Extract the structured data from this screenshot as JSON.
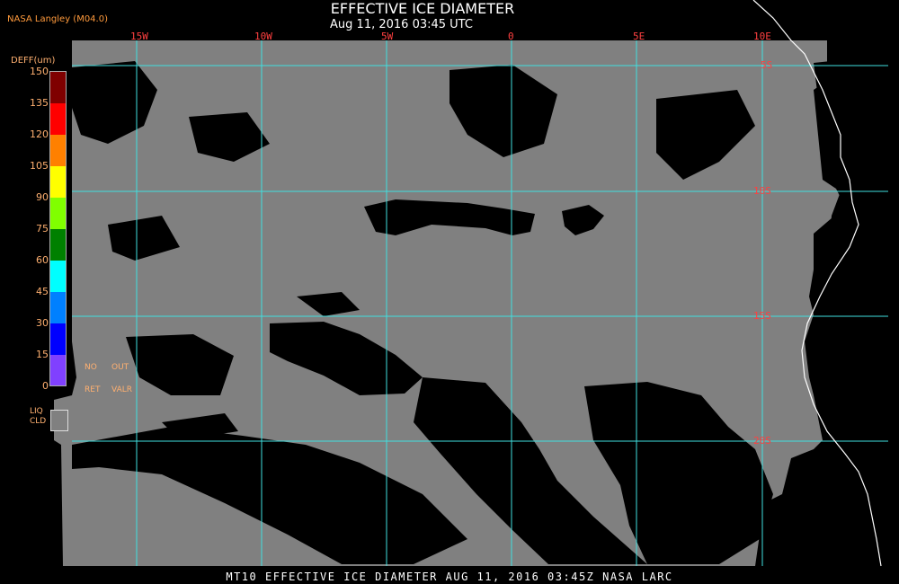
{
  "header": {
    "org": "NASA Langley (M04.0)",
    "title": "EFFECTIVE ICE DIAMETER",
    "subtitle": "Aug 11, 2016 03:45 UTC"
  },
  "legend": {
    "units_label": "DEFF(um)",
    "ticks": [
      "150",
      "135",
      "120",
      "105",
      "90",
      "75",
      "60",
      "45",
      "30",
      "15",
      "0"
    ],
    "colors": [
      "#7f0000",
      "#ff0000",
      "#ff8000",
      "#ffff00",
      "#80ff00",
      "#008000",
      "#00ffff",
      "#0080ff",
      "#0000ff",
      "#8040ff"
    ],
    "no_ret": [
      "NO",
      "RET"
    ],
    "out_valr": [
      "OUT",
      "VALR"
    ],
    "liq_cld": [
      "LIQ",
      "CLD"
    ]
  },
  "map": {
    "lon_labels": [
      "15W",
      "10W",
      "5W",
      "0",
      "5E",
      "10E"
    ],
    "lat_labels": [
      "5S",
      "10S",
      "15S",
      "20S"
    ],
    "grid_color": "#40e0e0",
    "cloud_color": "#808080",
    "coast_color": "#ffffff"
  },
  "footer": {
    "text": "MT10  EFFECTIVE ICE DIAMETER  AUG 11, 2016 03:45Z  NASA LARC"
  }
}
